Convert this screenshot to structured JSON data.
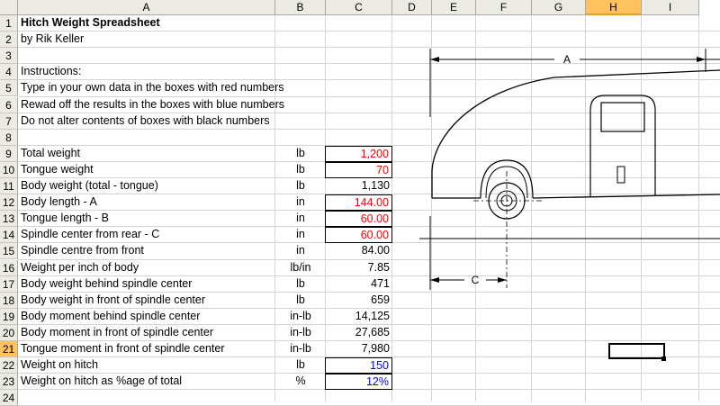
{
  "columns": [
    "A",
    "B",
    "C",
    "D",
    "E",
    "F",
    "G",
    "H",
    "I"
  ],
  "selected_column": "H",
  "selected_row": "21",
  "rows": [
    {
      "n": "1",
      "a": "Hitch Weight Spreadsheet",
      "b": "",
      "c": "",
      "style": "title"
    },
    {
      "n": "2",
      "a": "by Rik Keller",
      "b": "",
      "c": ""
    },
    {
      "n": "3",
      "a": "",
      "b": "",
      "c": ""
    },
    {
      "n": "4",
      "a": "Instructions:",
      "b": "",
      "c": ""
    },
    {
      "n": "5",
      "a": "Type in your own data in the boxes with red numbers",
      "b": "",
      "c": ""
    },
    {
      "n": "6",
      "a": "Rewad off the results in the boxes with blue numbers",
      "b": "",
      "c": ""
    },
    {
      "n": "7",
      "a": "Do not alter contents of boxes with black numbers",
      "b": "",
      "c": ""
    },
    {
      "n": "8",
      "a": "",
      "b": "",
      "c": ""
    },
    {
      "n": "9",
      "a": "Total weight",
      "b": "lb",
      "c": "1,200",
      "style": "red"
    },
    {
      "n": "10",
      "a": "Tongue weight",
      "b": "lb",
      "c": "70",
      "style": "red"
    },
    {
      "n": "11",
      "a": "Body weight (total - tongue)",
      "b": "lb",
      "c": "1,130"
    },
    {
      "n": "12",
      "a": "Body length - A",
      "b": "in",
      "c": "144.00",
      "style": "red"
    },
    {
      "n": "13",
      "a": "Tongue length - B",
      "b": "in",
      "c": "60.00",
      "style": "red"
    },
    {
      "n": "14",
      "a": "Spindle center from rear - C",
      "b": "in",
      "c": "60.00",
      "style": "red"
    },
    {
      "n": "15",
      "a": "Spindle centre from front",
      "b": "in",
      "c": "84.00"
    },
    {
      "n": "16",
      "a": "Weight per inch of body",
      "b": "lb/in",
      "c": "7.85"
    },
    {
      "n": "17",
      "a": "Body weight behind spindle center",
      "b": "lb",
      "c": "471"
    },
    {
      "n": "18",
      "a": "Body weight in front of spindle center",
      "b": "lb",
      "c": "659"
    },
    {
      "n": "19",
      "a": "Body moment behind spindle center",
      "b": "in-lb",
      "c": "14,125"
    },
    {
      "n": "20",
      "a": "Body moment in front of spindle center",
      "b": "in-lb",
      "c": "27,685"
    },
    {
      "n": "21",
      "a": "Tongue moment in front of spindle center",
      "b": "in-lb",
      "c": "7,980"
    },
    {
      "n": "22",
      "a": "Weight on hitch",
      "b": "lb",
      "c": "150",
      "style": "blue"
    },
    {
      "n": "23",
      "a": "Weight on hitch as %age of total",
      "b": "%",
      "c": "12%",
      "style": "blue"
    },
    {
      "n": "24",
      "a": "",
      "b": "",
      "c": ""
    }
  ],
  "diagram": {
    "label_a": "A",
    "label_c": "C"
  },
  "colors": {
    "input_red": "#ff0000",
    "output_blue": "#0000ff",
    "header_bg": "#ecebe3",
    "header_selected": "#ffc25e"
  }
}
